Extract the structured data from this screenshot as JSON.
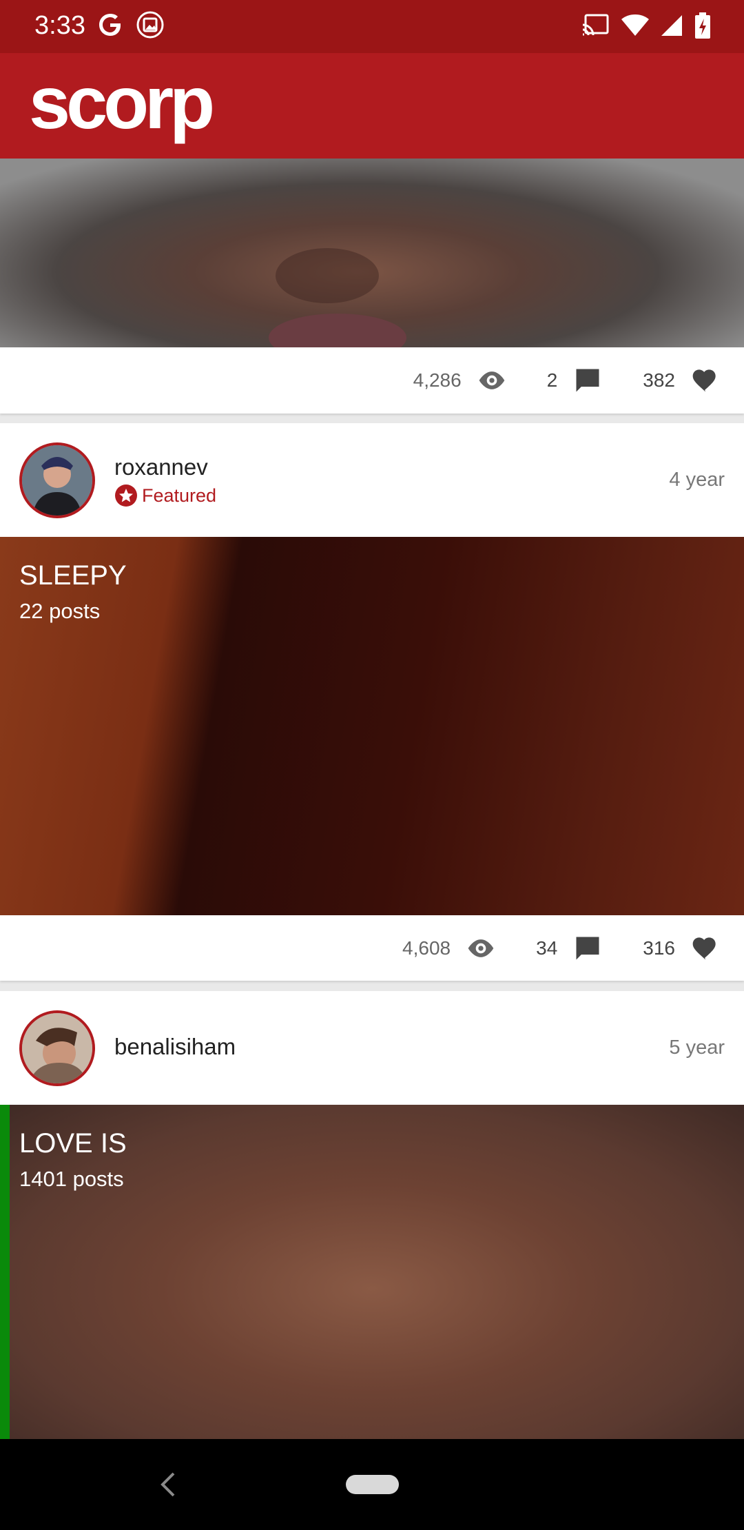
{
  "status_bar": {
    "time": "3:33",
    "icons_left": [
      "google-icon",
      "photo-icon"
    ],
    "icons_right": [
      "cast-icon",
      "wifi-icon",
      "signal-icon",
      "battery-charging-icon"
    ]
  },
  "app_bar": {
    "logo": "scorp",
    "color": "#b11b1f"
  },
  "feed": {
    "posts": [
      {
        "views": "4,286",
        "comments": "2",
        "likes": "382"
      },
      {
        "username": "roxannev",
        "badge": "Featured",
        "time_ago": "4 year",
        "title": "SLEEPY",
        "post_count": "22 posts",
        "views": "4,608",
        "comments": "34",
        "likes": "316"
      },
      {
        "username": "benalisiham",
        "time_ago": "5 year",
        "title": "LOVE  IS",
        "post_count": "1401 posts"
      }
    ]
  },
  "nav_bar": {
    "icons": [
      "back-icon",
      "home-pill"
    ]
  }
}
